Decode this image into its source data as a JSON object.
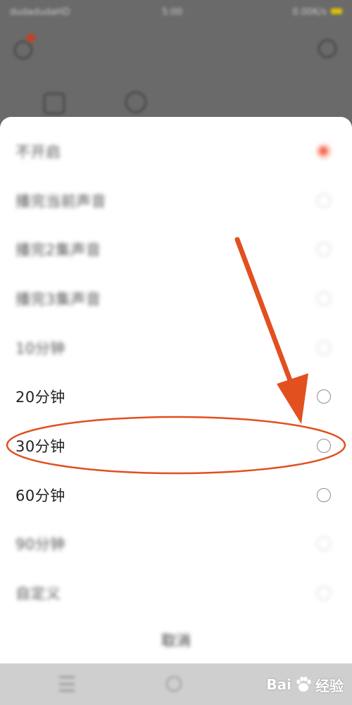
{
  "status_bar": {
    "carrier": "dudadudaHD",
    "time": "5:00",
    "right": "0.00K/s"
  },
  "sheet": {
    "options": [
      {
        "label": "不开启",
        "selected": true,
        "blurred": true
      },
      {
        "label": "播完当前声音",
        "selected": false,
        "blurred": true
      },
      {
        "label": "播完2集声音",
        "selected": false,
        "blurred": true
      },
      {
        "label": "播完3集声音",
        "selected": false,
        "blurred": true
      },
      {
        "label": "10分钟",
        "selected": false,
        "blurred": true
      },
      {
        "label": "20分钟",
        "selected": false,
        "blurred": false
      },
      {
        "label": "30分钟",
        "selected": false,
        "blurred": false
      },
      {
        "label": "60分钟",
        "selected": false,
        "blurred": false
      },
      {
        "label": "90分钟",
        "selected": false,
        "blurred": true
      },
      {
        "label": "自定义",
        "selected": false,
        "blurred": true
      }
    ],
    "cancel_label": "取消"
  },
  "watermark": {
    "text": "Bai",
    "text2": "经验"
  },
  "colors": {
    "accent": "#f2684a",
    "annotation": "#e2501f",
    "overlay": "#6a6a6a"
  }
}
